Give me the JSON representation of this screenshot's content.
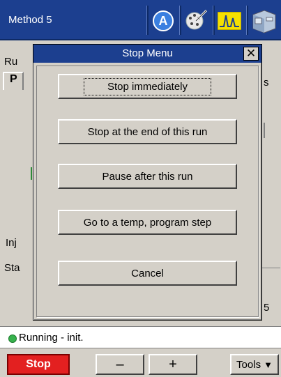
{
  "window": {
    "title": "Method 5"
  },
  "toolbar_icons": [
    "a-circle-icon",
    "syringe-icon",
    "chromatogram-icon",
    "instrument-icon"
  ],
  "background": {
    "tab_row_label": "Ru",
    "tab_label": "P",
    "frag_s": "s",
    "frag_inj": "Inj",
    "frag_sta": "Sta",
    "frag_5": "5"
  },
  "dialog": {
    "title": "Stop Menu",
    "close_label": "✕",
    "buttons": {
      "stop_immediately": "Stop immediately",
      "stop_end_of_run": "Stop at the end of this run",
      "pause_after_run": "Pause after this run",
      "go_to_temp_step": "Go to a temp, program step",
      "cancel": "Cancel"
    }
  },
  "status": {
    "text": "Running - init.",
    "dot_color": "#37b24d"
  },
  "bottom": {
    "stop_label": "Stop",
    "minus_label": "–",
    "plus_label": "+",
    "tools_label": "Tools",
    "tools_arrow": "▼"
  }
}
